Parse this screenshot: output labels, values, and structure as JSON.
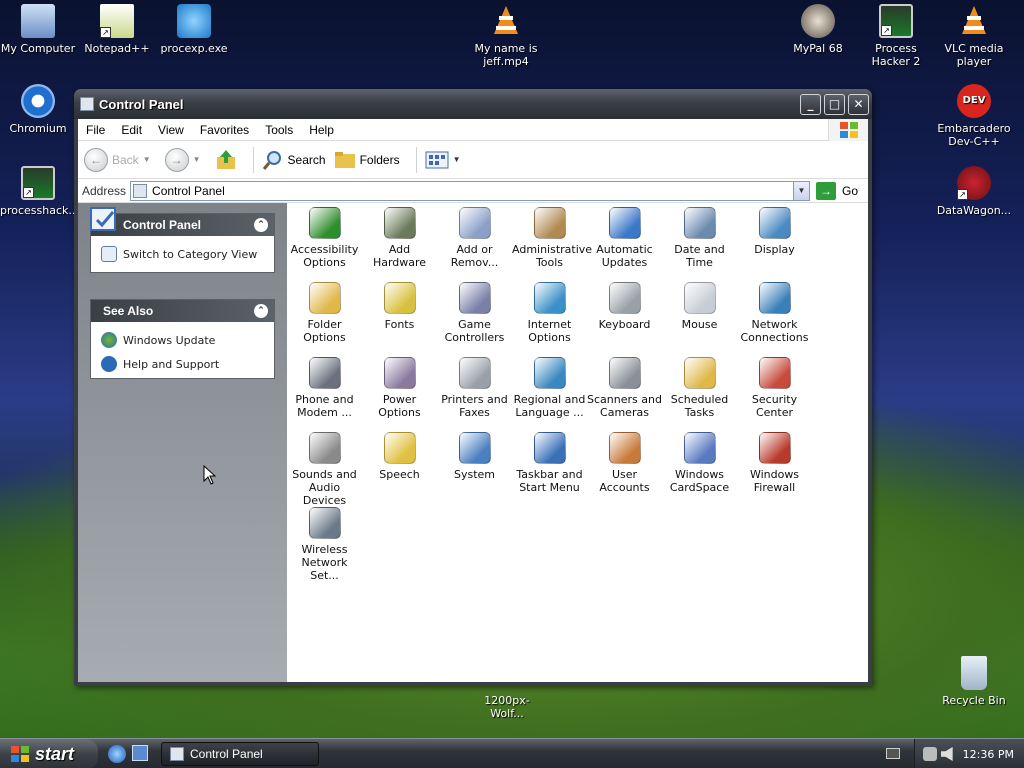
{
  "desktop_icons": [
    {
      "label": "My Computer",
      "icon": "computer-icon"
    },
    {
      "label": "Notepad++",
      "icon": "notepad-icon"
    },
    {
      "label": "procexp.exe",
      "icon": "procexp-icon"
    },
    {
      "label": "My name is jeff.mp4",
      "icon": "vlc-cone-icon"
    },
    {
      "label": "MyPal 68",
      "icon": "mypal-icon"
    },
    {
      "label": "Process Hacker 2",
      "icon": "process-hacker-icon"
    },
    {
      "label": "VLC media player",
      "icon": "vlc-cone-icon"
    },
    {
      "label": "Chromium",
      "icon": "chromium-icon"
    },
    {
      "label": "Embarcadero Dev-C++",
      "icon": "devcpp-icon"
    },
    {
      "label": "processhack...",
      "icon": "process-hacker-icon"
    },
    {
      "label": "DataWagon...",
      "icon": "datawagon-icon"
    },
    {
      "label": "1200px-Wolf...",
      "icon": "image-file-icon"
    },
    {
      "label": "Recycle Bin",
      "icon": "recycle-bin-icon"
    }
  ],
  "window": {
    "title": "Control Panel",
    "menu": [
      "File",
      "Edit",
      "View",
      "Favorites",
      "Tools",
      "Help"
    ],
    "toolbar": {
      "back": "Back",
      "search": "Search",
      "folders": "Folders"
    },
    "address": {
      "label": "Address",
      "value": "Control Panel",
      "go": "Go"
    },
    "task_pane": {
      "control_panel": {
        "title": "Control Panel",
        "link": "Switch to Category View"
      },
      "see_also": {
        "title": "See Also",
        "links": [
          "Windows Update",
          "Help and Support"
        ]
      }
    },
    "items": [
      {
        "label": "Accessibility Options",
        "color": "#2f8f2f"
      },
      {
        "label": "Add Hardware",
        "color": "#6a7a5a"
      },
      {
        "label": "Add or Remov...",
        "color": "#8aa0c8"
      },
      {
        "label": "Administrative Tools",
        "color": "#b08a50"
      },
      {
        "label": "Automatic Updates",
        "color": "#3a78c8"
      },
      {
        "label": "Date and Time",
        "color": "#6a8ab0"
      },
      {
        "label": "Display",
        "color": "#4a8ac0"
      },
      {
        "label": "Folder Options",
        "color": "#e0b84a"
      },
      {
        "label": "Fonts",
        "color": "#d8c040"
      },
      {
        "label": "Game Controllers",
        "color": "#7a80a8"
      },
      {
        "label": "Internet Options",
        "color": "#3a90c8"
      },
      {
        "label": "Keyboard",
        "color": "#9aa0a8"
      },
      {
        "label": "Mouse",
        "color": "#c8ccd4"
      },
      {
        "label": "Network Connections",
        "color": "#3a80b8"
      },
      {
        "label": "Phone and Modem ...",
        "color": "#6a7080"
      },
      {
        "label": "Power Options",
        "color": "#8a7aa0"
      },
      {
        "label": "Printers and Faxes",
        "color": "#9aa0a8"
      },
      {
        "label": "Regional and Language ...",
        "color": "#3a88c0"
      },
      {
        "label": "Scanners and Cameras",
        "color": "#8a8f98"
      },
      {
        "label": "Scheduled Tasks",
        "color": "#e0b84a"
      },
      {
        "label": "Security Center",
        "color": "#c84a3a"
      },
      {
        "label": "Sounds and Audio Devices",
        "color": "#8a8a8a"
      },
      {
        "label": "Speech",
        "color": "#e0c040"
      },
      {
        "label": "System",
        "color": "#4a80c0"
      },
      {
        "label": "Taskbar and Start Menu",
        "color": "#3a70b8"
      },
      {
        "label": "User Accounts",
        "color": "#c87a3a"
      },
      {
        "label": "Windows CardSpace",
        "color": "#5a7ac0"
      },
      {
        "label": "Windows Firewall",
        "color": "#b83a2a"
      },
      {
        "label": "Wireless Network Set...",
        "color": "#6a7a8a"
      }
    ]
  },
  "taskbar": {
    "start": "start",
    "task": "Control Panel",
    "clock": "12:36 PM"
  }
}
